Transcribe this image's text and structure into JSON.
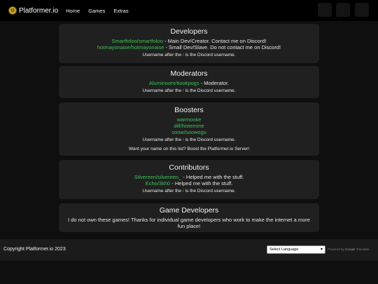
{
  "brand": {
    "name": "Platformer.io",
    "logo_icon": "gear-icon"
  },
  "nav": {
    "items": [
      "Home",
      "Games",
      "Extras"
    ]
  },
  "header_buttons": [
    "blank-button-1",
    "blank-button-2",
    "blank-button-3"
  ],
  "developers": {
    "title": "Developers",
    "entries": [
      {
        "name": "Smartfoloo/smartfoloo",
        "desc": " - Main Dev/Creator. Contact me on Discord!"
      },
      {
        "name": "hotmayonaise/hotmayonaise",
        "desc": " - Small Dev/Slave. Do not contact me on Discord!"
      }
    ],
    "note_a": "Username after the ",
    "note_slash": "/",
    "note_b": " is the Discord username."
  },
  "moderators": {
    "title": "Moderators",
    "entries": [
      {
        "name": "Aluminoom/itookpogs",
        "desc": " - Moderator."
      }
    ],
    "note_a": "Username after the ",
    "note_slash": "/",
    "note_b": " is the Discord username."
  },
  "boosters": {
    "title": "Boosters",
    "entries": [
      "warmonke",
      "dill/histemine",
      "soow/soowogu"
    ],
    "note_a": "Username after the ",
    "note_slash": "/",
    "note_b": " is the Discord username.",
    "cta": "Want your name on this list? Boost the Platformer.io Server!"
  },
  "contributors": {
    "title": "Contributors",
    "entries": [
      {
        "name": "Silvereen/silvereen_",
        "desc": " - Helped me with the stuff."
      },
      {
        "name": "Echo/3kh0",
        "desc": " - Helped me with the stuff."
      }
    ],
    "note_a": "Username after the ",
    "note_slash": "/",
    "note_b": " is the Discord username."
  },
  "game_developers": {
    "title": "Game Developers",
    "text": "I do not own these games! Thanks for individual game developers who work to make the internet a more fun place!"
  },
  "footer": {
    "copyright": "Copyright Platformer.io 2023",
    "language_select": "Select Language",
    "powered_by": "Powered by",
    "google": "Google",
    "translate": "Translate"
  },
  "colors": {
    "accent_green": "#3ec15a",
    "background": "#0f0f0f",
    "card": "#202020",
    "footer": "#1b1b1b"
  }
}
